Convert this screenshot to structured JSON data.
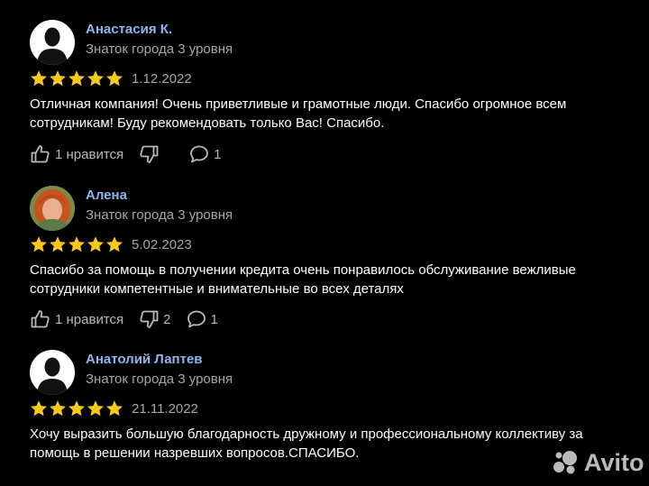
{
  "reviews": [
    {
      "author": "Анастасия К.",
      "level": "Знаток города 3 уровня",
      "rating": 5,
      "date": "1.12.2022",
      "text": "Отличная компания! Очень приветливые и грамотные люди. Спасибо огромное всем сотрудникам! Буду рекомендовать только Вас! Спасибо.",
      "likes_label": "1 нравится",
      "dislikes": "",
      "comments": "1",
      "avatar": "default-silhouette"
    },
    {
      "author": "Алена",
      "level": "Знаток города 3 уровня",
      "rating": 5,
      "date": "5.02.2023",
      "text": "Спасибо за помощь в получении кредита очень понравилось обслуживание вежливые сотрудники компетентные и внимательные во всех деталях",
      "likes_label": "1 нравится",
      "dislikes": "2",
      "comments": "1",
      "avatar": "photo"
    },
    {
      "author": "Анатолий Лаптев",
      "level": "Знаток города 3 уровня",
      "rating": 5,
      "date": "21.11.2022",
      "text": "Хочу выразить большую благодарность дружному и профессиональному коллективу за помощь в решении назревших вопросов.СПАСИБО.",
      "avatar": "default-silhouette"
    }
  ],
  "watermark": {
    "text": "Avito"
  },
  "colors": {
    "background": "#000000",
    "author_name": "#8db6ee",
    "secondary_text": "#a7a7a7",
    "star": "#f7c91a",
    "action": "#b9b9b9"
  },
  "icons": [
    "avatar-silhouette",
    "star-icon",
    "thumbs-up-icon",
    "thumbs-down-icon",
    "comment-icon",
    "avito-logo-icon"
  ]
}
